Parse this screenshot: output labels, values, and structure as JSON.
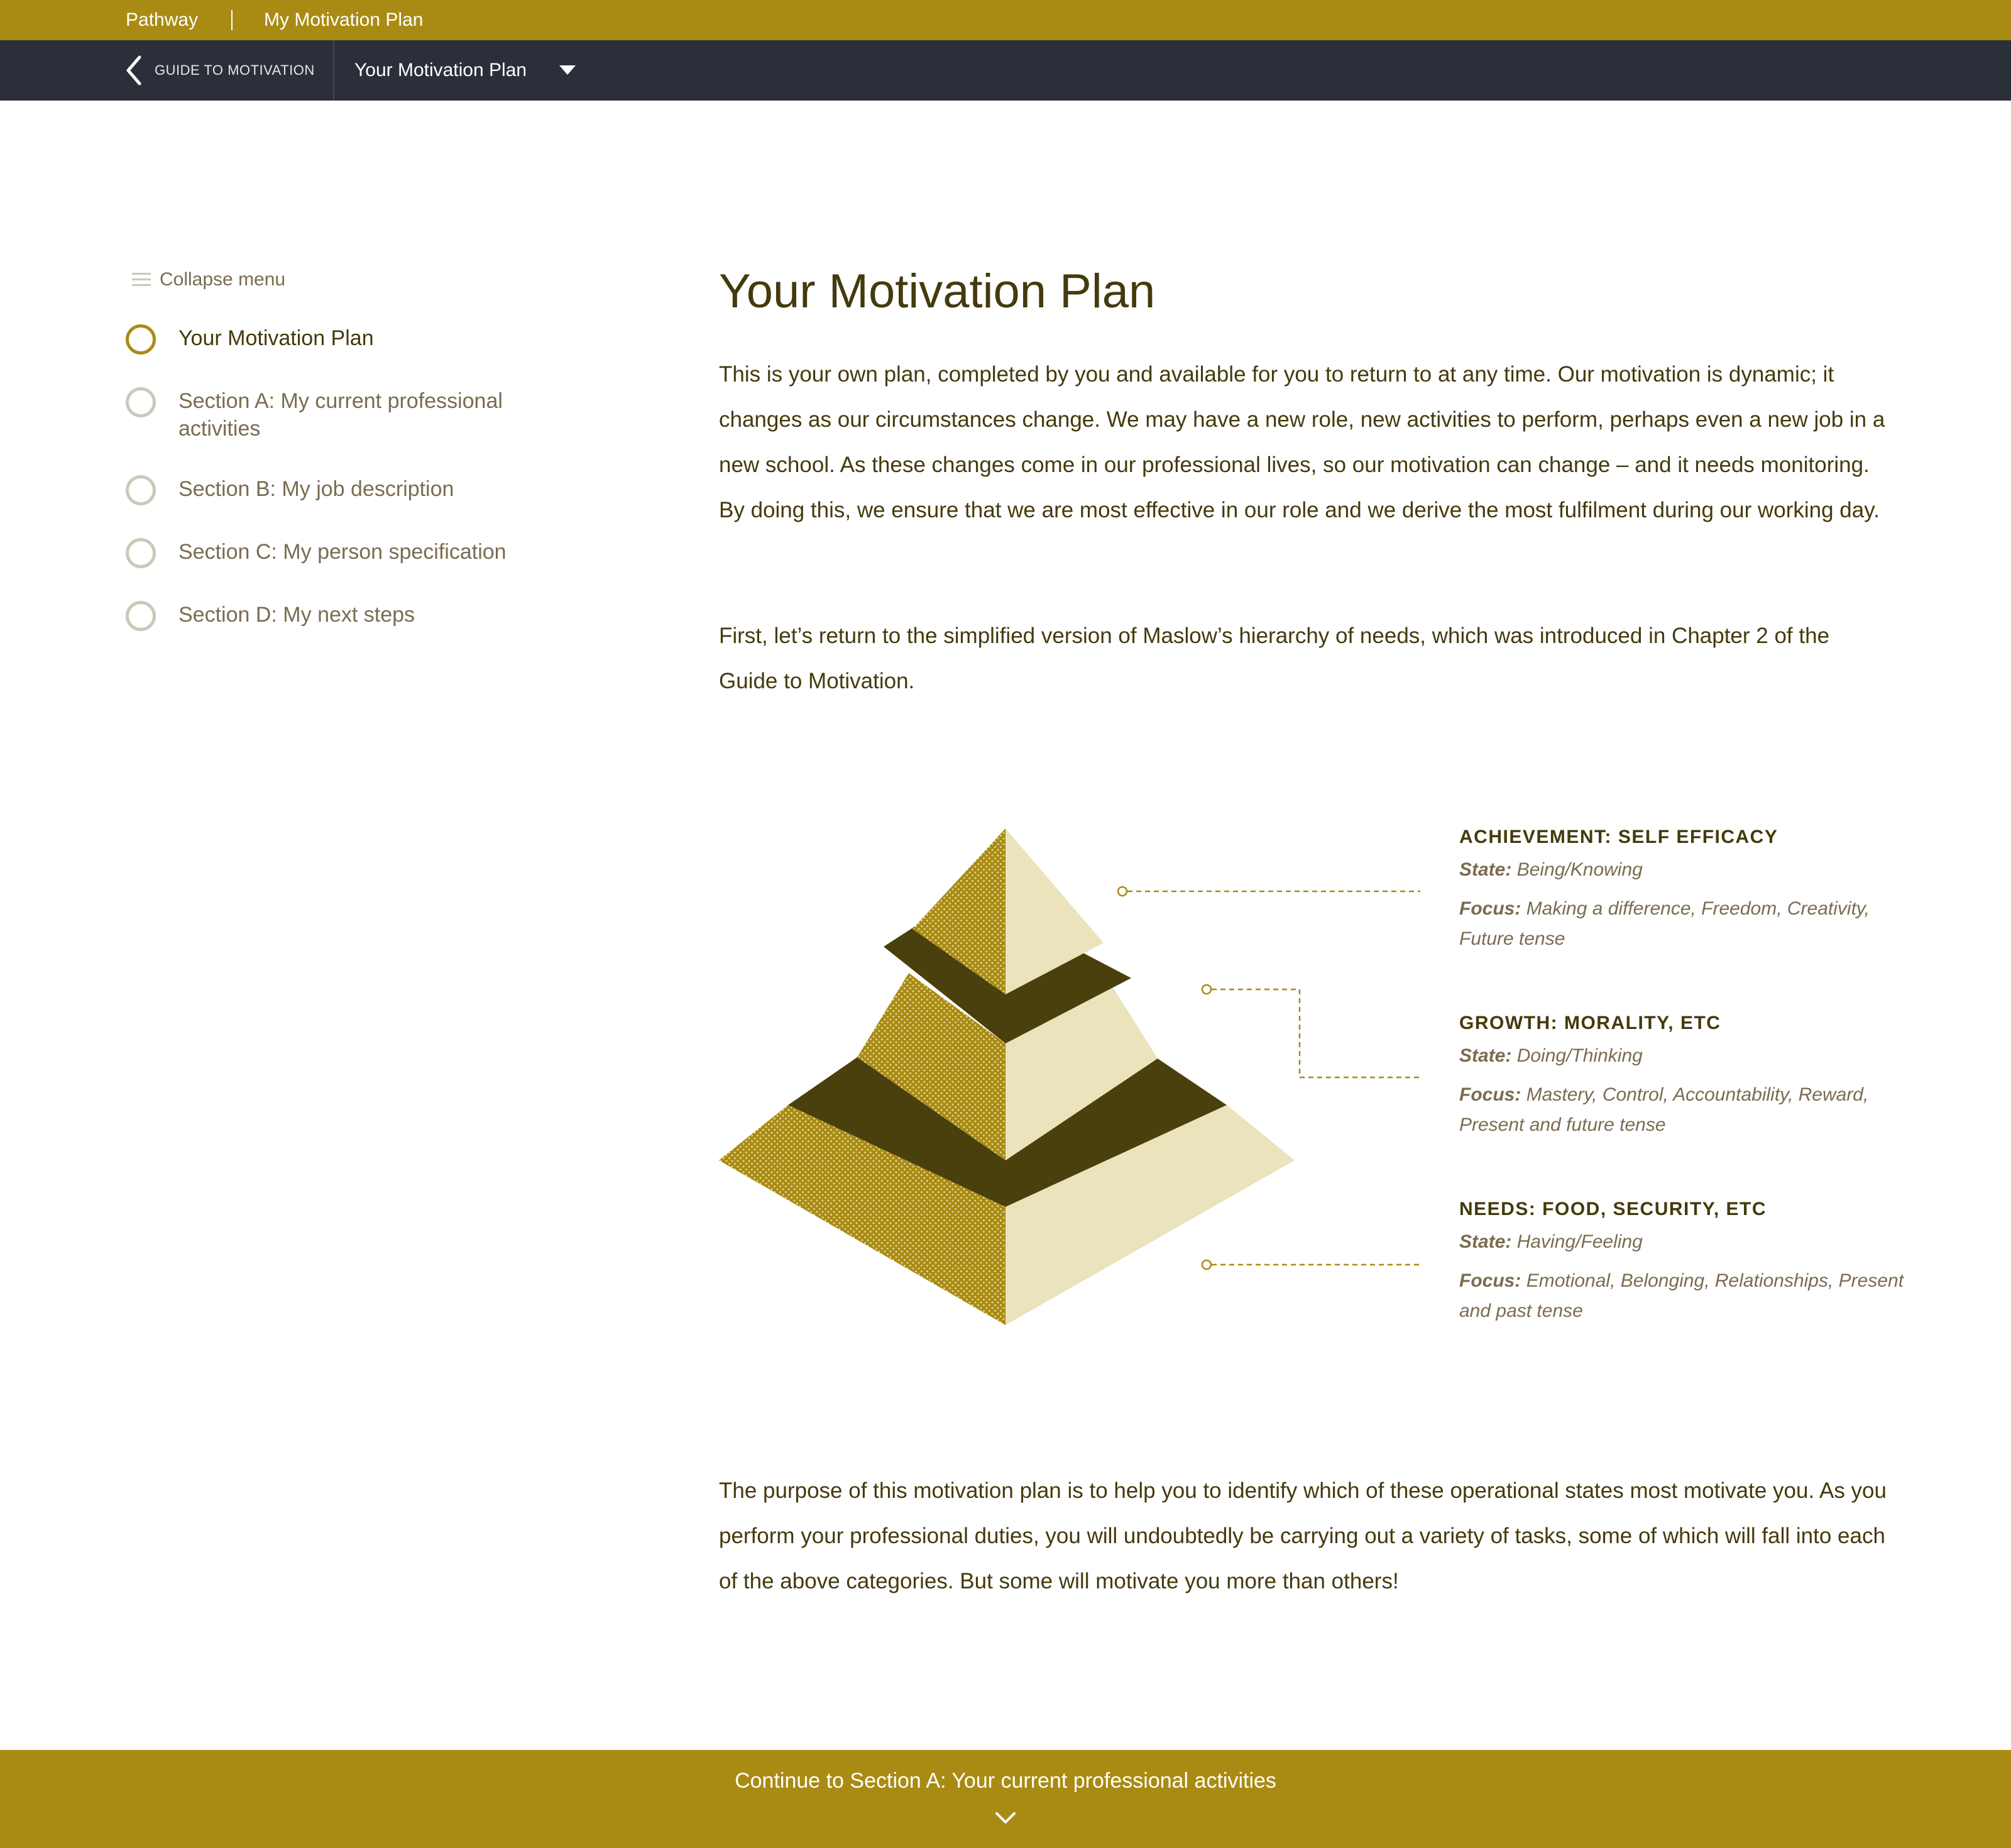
{
  "topbar": {
    "crumb_home": "Pathway",
    "crumb_current": "My Motivation Plan"
  },
  "navbar": {
    "back_label": "GUIDE TO MOTIVATION",
    "current_label": "Your Motivation Plan"
  },
  "sidebar": {
    "collapse_label": "Collapse menu",
    "items": [
      {
        "label": "Your Motivation Plan",
        "active": true
      },
      {
        "label": "Section A: My current professional activities",
        "active": false
      },
      {
        "label": "Section B: My job description",
        "active": false
      },
      {
        "label": "Section C: My person specification",
        "active": false
      },
      {
        "label": "Section D: My next steps",
        "active": false
      }
    ]
  },
  "main": {
    "title": "Your Motivation Plan",
    "para1": "This is your own plan, completed by you and available for you to return to at any time. Our motivation is dynamic; it changes as our circumstances change. We may have a new role, new activities to perform, perhaps even a new job in a new school. As these changes come in our professional lives, so our motivation can change – and it needs monitoring. By doing this, we ensure that we are most effective in our role and we derive the most fulfilment during our working day.",
    "para2": "First, let’s return to the simplified version of Maslow’s hierarchy of needs, which was introduced in Chapter 2 of the Guide to Motivation.",
    "para3": "The purpose of this motivation plan is to help you to identify which of these operational states most motivate you. As you perform your professional duties, you will undoubtedly be carrying out a variety of tasks, some of which will fall into each of the above categories. But some will motivate you more than others!"
  },
  "diagram": {
    "state_label": "State:",
    "focus_label": "Focus:",
    "levels": [
      {
        "heading": "ACHIEVEMENT: SELF EFFICACY",
        "state": "Being/Knowing",
        "focus": "Making a difference, Freedom, Creativity, Future tense"
      },
      {
        "heading": "GROWTH: MORALITY, ETC",
        "state": "Doing/Thinking",
        "focus": "Mastery, Control, Accountability, Reward, Present and future tense"
      },
      {
        "heading": "NEEDS: FOOD, SECURITY, ETC",
        "state": "Having/Feeling",
        "focus": "Emotional, Belonging, Relationships, Present and past tense"
      }
    ],
    "colors": {
      "gold": "#a98b13",
      "cream": "#eae3bb",
      "dark": "#4a400d",
      "connector": "#a98b13"
    }
  },
  "footer": {
    "cta_label": "Continue to Section A: Your current professional activities"
  },
  "colors": {
    "brand_gold": "#a98b13",
    "nav_dark": "#2b2f3a",
    "text_dark": "#443a0c",
    "text_muted": "#7a6c51"
  }
}
